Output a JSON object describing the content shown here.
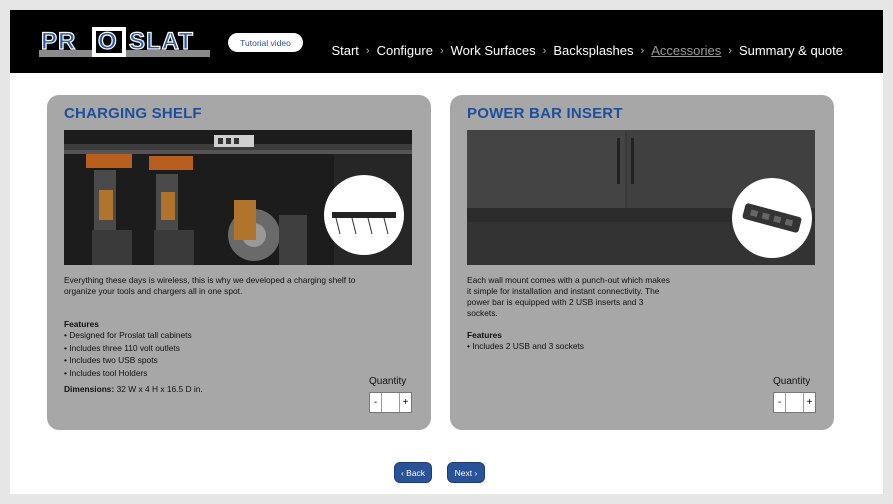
{
  "header": {
    "logo_text": "PROSLAT",
    "tutorial_label": "Tutorial video",
    "nav": [
      {
        "label": "Start",
        "current": false
      },
      {
        "label": "Configure",
        "current": false
      },
      {
        "label": "Work Surfaces",
        "current": false
      },
      {
        "label": "Backsplashes",
        "current": false
      },
      {
        "label": "Accessories",
        "current": true
      },
      {
        "label": "Summary & quote",
        "current": false
      }
    ],
    "separator": "›"
  },
  "products": [
    {
      "title": "CHARGING SHELF",
      "description": "Everything these days is wireless, this is why we developed a charging shelf to organize your tools and chargers all in one spot.",
      "features_title": "Features",
      "features": [
        "• Designed for Proslat tall cabinets",
        "• Includes three 110 volt outlets",
        "• Includes two USB spots",
        "• Includes tool Holders"
      ],
      "dimensions_label": "Dimensions:",
      "dimensions_value": " 32 W  x  4 H x 16.5 D in.",
      "quantity_label": "Quantity",
      "quantity_value": "",
      "minus": "-",
      "plus": "+"
    },
    {
      "title": "POWER BAR INSERT",
      "description": "Each wall mount comes with a punch-out which makes it simple for installation and instant connectivity. The power bar is equipped with 2 USB inserts and 3 sockets.",
      "features_title": "Features",
      "features": [
        "• Includes 2 USB and 3 sockets"
      ],
      "quantity_label": "Quantity",
      "quantity_value": "",
      "minus": "-",
      "plus": "+"
    }
  ],
  "footer": {
    "back_label": "‹ Back",
    "next_label": "Next ›"
  },
  "colors": {
    "header_bg": "#000000",
    "card_bg": "#a7a7a7",
    "title_blue": "#1f4f9a",
    "button_blue": "#2a5298"
  }
}
